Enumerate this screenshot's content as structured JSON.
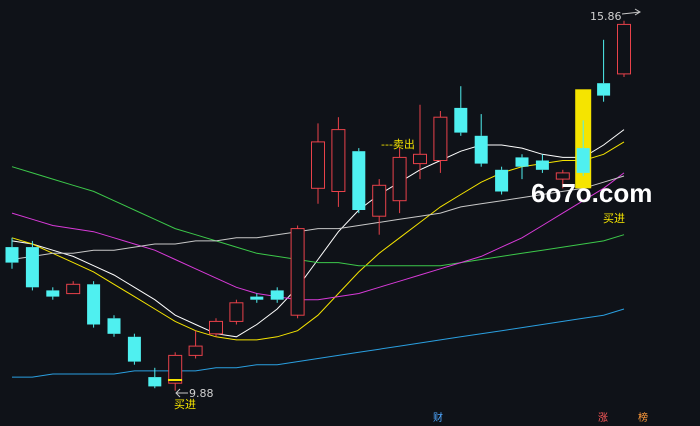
{
  "chart_data": {
    "type": "candlestick",
    "title": "",
    "xlabel": "",
    "ylabel": "",
    "ylim": [
      9.6,
      16.0
    ],
    "grid": false,
    "candles": [
      {
        "o": 12.2,
        "h": 12.35,
        "l": 11.85,
        "c": 11.95
      },
      {
        "o": 12.2,
        "h": 12.3,
        "l": 11.5,
        "c": 11.55
      },
      {
        "o": 11.5,
        "h": 11.55,
        "l": 11.35,
        "c": 11.4
      },
      {
        "o": 11.45,
        "h": 11.65,
        "l": 11.45,
        "c": 11.6
      },
      {
        "o": 11.6,
        "h": 11.65,
        "l": 10.9,
        "c": 10.95
      },
      {
        "o": 11.05,
        "h": 11.1,
        "l": 10.75,
        "c": 10.8
      },
      {
        "o": 10.75,
        "h": 10.8,
        "l": 10.3,
        "c": 10.35
      },
      {
        "o": 10.1,
        "h": 10.25,
        "l": 9.92,
        "c": 9.95
      },
      {
        "o": 10.0,
        "h": 10.5,
        "l": 9.88,
        "c": 10.45
      },
      {
        "o": 10.45,
        "h": 10.85,
        "l": 10.4,
        "c": 10.6
      },
      {
        "o": 10.8,
        "h": 11.05,
        "l": 10.75,
        "c": 11.0
      },
      {
        "o": 11.0,
        "h": 11.35,
        "l": 10.95,
        "c": 11.3
      },
      {
        "o": 11.4,
        "h": 11.45,
        "l": 11.3,
        "c": 11.35
      },
      {
        "o": 11.5,
        "h": 11.55,
        "l": 11.3,
        "c": 11.35
      },
      {
        "o": 11.1,
        "h": 12.55,
        "l": 11.05,
        "c": 12.5
      },
      {
        "o": 13.15,
        "h": 14.2,
        "l": 12.9,
        "c": 13.9
      },
      {
        "o": 13.1,
        "h": 14.3,
        "l": 12.85,
        "c": 14.1
      },
      {
        "o": 13.75,
        "h": 13.8,
        "l": 12.75,
        "c": 12.8
      },
      {
        "o": 12.7,
        "h": 13.3,
        "l": 12.4,
        "c": 13.2
      },
      {
        "o": 12.95,
        "h": 13.8,
        "l": 12.75,
        "c": 13.65
      },
      {
        "o": 13.55,
        "h": 14.5,
        "l": 13.3,
        "c": 13.7
      },
      {
        "o": 13.6,
        "h": 14.4,
        "l": 13.4,
        "c": 14.3
      },
      {
        "o": 14.45,
        "h": 14.8,
        "l": 14.0,
        "c": 14.05
      },
      {
        "o": 14.0,
        "h": 14.35,
        "l": 13.5,
        "c": 13.55
      },
      {
        "o": 13.45,
        "h": 13.5,
        "l": 13.05,
        "c": 13.1
      },
      {
        "o": 13.65,
        "h": 13.7,
        "l": 13.3,
        "c": 13.5
      },
      {
        "o": 13.6,
        "h": 13.7,
        "l": 13.4,
        "c": 13.45
      },
      {
        "o": 13.3,
        "h": 13.45,
        "l": 13.15,
        "c": 13.4
      },
      {
        "o": 13.8,
        "h": 14.25,
        "l": 13.35,
        "c": 13.4
      },
      {
        "o": 14.85,
        "h": 15.55,
        "l": 14.55,
        "c": 14.65
      },
      {
        "o": 15.0,
        "h": 15.86,
        "l": 14.95,
        "c": 15.8
      }
    ],
    "candle_colors": {
      "up": "#e8424a",
      "down": "#4ff0f0",
      "flat": "#f5e400"
    },
    "moving_averages": [
      {
        "color": "#ffffff",
        "values": [
          12.3,
          12.25,
          12.15,
          12.05,
          11.9,
          11.75,
          11.55,
          11.35,
          11.1,
          10.95,
          10.8,
          10.75,
          10.95,
          11.2,
          11.55,
          12.0,
          12.45,
          12.8,
          13.05,
          13.25,
          13.45,
          13.6,
          13.75,
          13.85,
          13.85,
          13.8,
          13.7,
          13.65,
          13.65,
          13.85,
          14.1
        ]
      },
      {
        "color": "#f5e400",
        "values": [
          12.35,
          12.25,
          12.1,
          11.95,
          11.8,
          11.6,
          11.4,
          11.2,
          11.0,
          10.85,
          10.75,
          10.7,
          10.7,
          10.75,
          10.85,
          11.1,
          11.45,
          11.8,
          12.1,
          12.35,
          12.6,
          12.85,
          13.05,
          13.25,
          13.4,
          13.5,
          13.55,
          13.6,
          13.6,
          13.7,
          13.9
        ]
      },
      {
        "color": "#3cc84a",
        "values": [
          13.5,
          13.4,
          13.3,
          13.2,
          13.1,
          12.95,
          12.8,
          12.65,
          12.5,
          12.4,
          12.3,
          12.2,
          12.1,
          12.05,
          12.0,
          11.95,
          11.95,
          11.9,
          11.9,
          11.9,
          11.9,
          11.9,
          11.95,
          12.0,
          12.05,
          12.1,
          12.15,
          12.2,
          12.25,
          12.3,
          12.4
        ]
      },
      {
        "color": "#d83ad8",
        "values": [
          12.75,
          12.65,
          12.55,
          12.5,
          12.45,
          12.35,
          12.25,
          12.15,
          12.0,
          11.85,
          11.7,
          11.55,
          11.45,
          11.4,
          11.35,
          11.35,
          11.4,
          11.45,
          11.55,
          11.65,
          11.75,
          11.85,
          11.95,
          12.05,
          12.2,
          12.35,
          12.55,
          12.75,
          12.95,
          13.15,
          13.4
        ]
      },
      {
        "color": "#2a9fe0",
        "values": [
          10.1,
          10.1,
          10.15,
          10.15,
          10.15,
          10.15,
          10.2,
          10.2,
          10.2,
          10.2,
          10.25,
          10.25,
          10.3,
          10.3,
          10.35,
          10.4,
          10.45,
          10.5,
          10.55,
          10.6,
          10.65,
          10.7,
          10.75,
          10.8,
          10.85,
          10.9,
          10.95,
          11.0,
          11.05,
          11.1,
          11.2
        ]
      },
      {
        "color": "#c8c8c8",
        "values": [
          12.0,
          12.05,
          12.1,
          12.1,
          12.15,
          12.15,
          12.2,
          12.25,
          12.25,
          12.3,
          12.3,
          12.35,
          12.35,
          12.4,
          12.45,
          12.5,
          12.5,
          12.55,
          12.6,
          12.65,
          12.7,
          12.75,
          12.85,
          12.9,
          12.95,
          13.0,
          13.05,
          13.1,
          13.15,
          13.25,
          13.35
        ]
      }
    ],
    "signal_bar": {
      "index": 28,
      "low": 13.15,
      "high": 14.75,
      "color": "#f5e400"
    },
    "annotations": {
      "sell_text": "---卖出",
      "buy_text_1": "买进",
      "buy_text_2": "买进",
      "low_label": "9.88",
      "high_label": "15.86"
    },
    "badges": [
      "财",
      "涨",
      "榜"
    ],
    "watermark": "6o7o.com"
  }
}
